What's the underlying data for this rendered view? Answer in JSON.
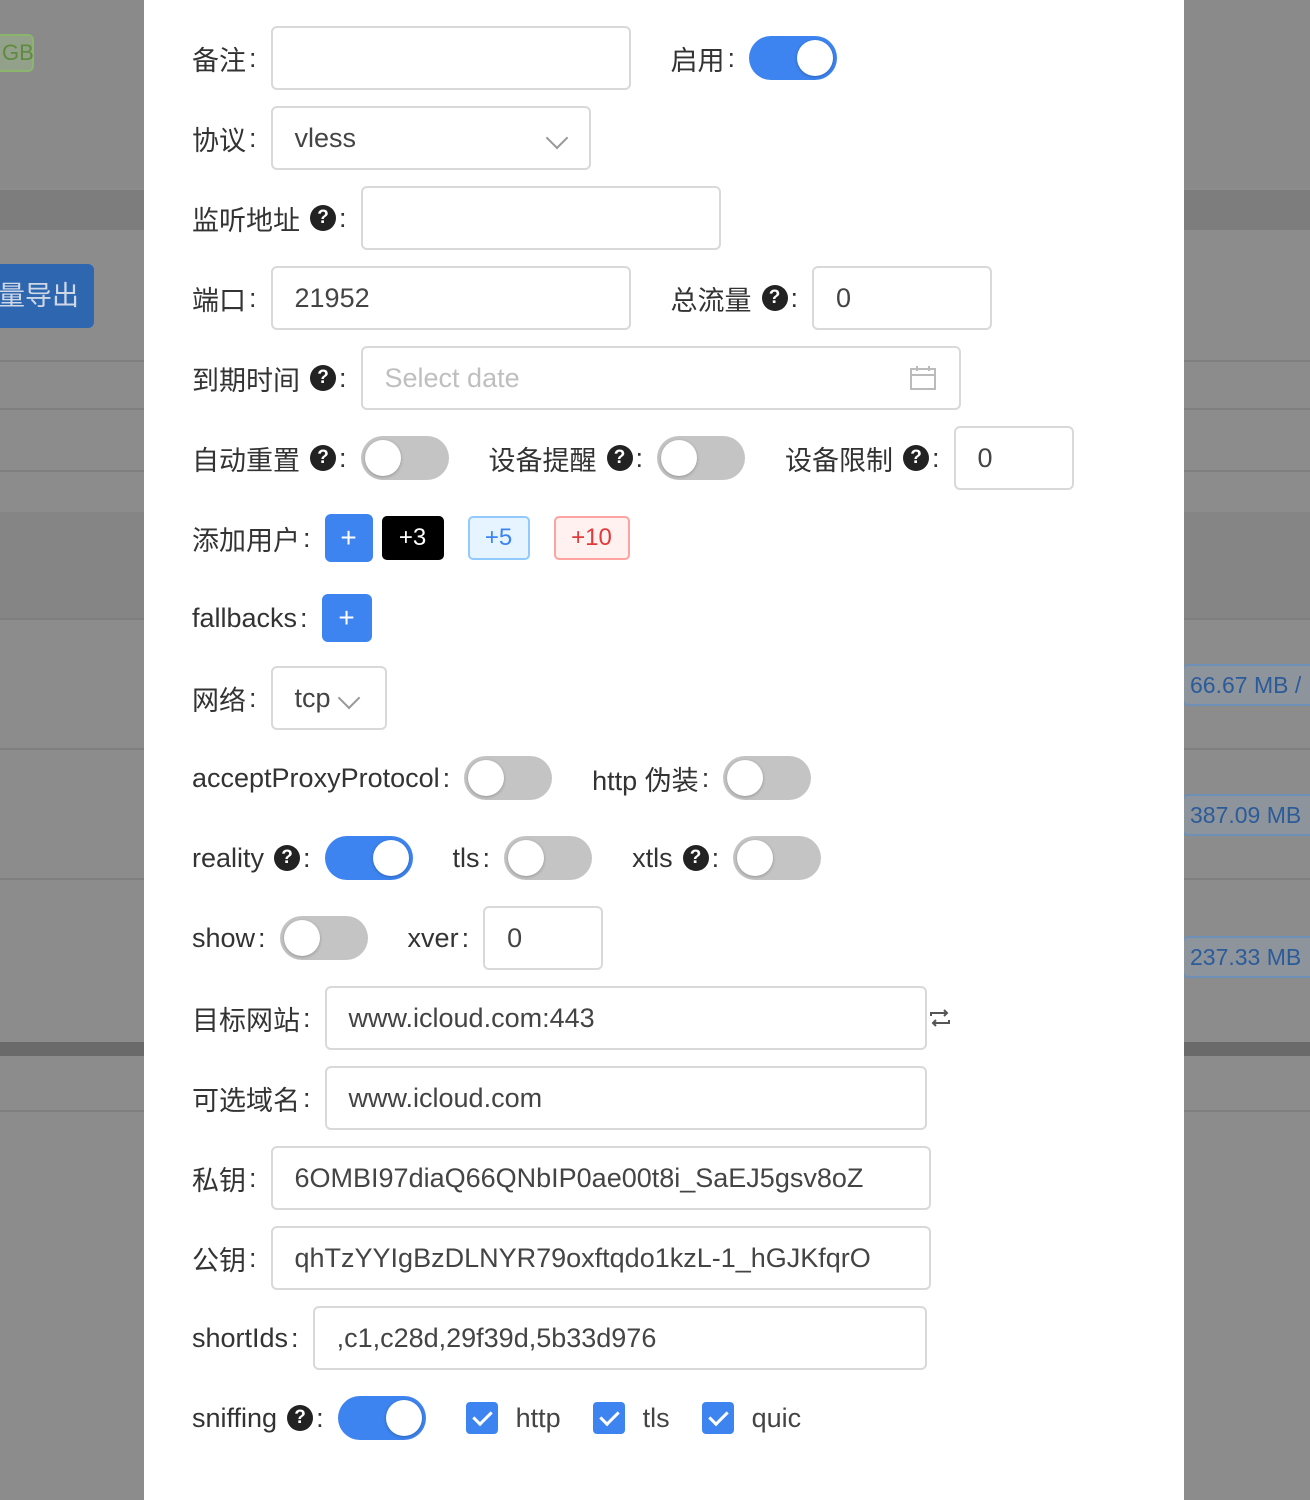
{
  "background": {
    "tag_text": "GB",
    "export_label": "量导出",
    "traffic_values": [
      "66.67 MB /",
      "387.09 MB",
      "237.33 MB"
    ]
  },
  "form": {
    "remark": {
      "label": "备注",
      "value": ""
    },
    "enable": {
      "label": "启用",
      "on": true
    },
    "protocol": {
      "label": "协议",
      "value": "vless"
    },
    "listen": {
      "label": "监听地址",
      "value": ""
    },
    "port": {
      "label": "端口",
      "value": "21952"
    },
    "total_traffic": {
      "label": "总流量",
      "value": "0"
    },
    "expiry": {
      "label": "到期时间",
      "placeholder": "Select date"
    },
    "auto_reset": {
      "label": "自动重置",
      "on": false
    },
    "device_alert": {
      "label": "设备提醒",
      "on": false
    },
    "device_limit": {
      "label": "设备限制",
      "value": "0"
    },
    "add_user": {
      "label": "添加用户",
      "plus": "+",
      "b3": "+3",
      "b5": "+5",
      "b10": "+10"
    },
    "fallbacks": {
      "label": "fallbacks",
      "plus": "+"
    },
    "network": {
      "label": "网络",
      "value": "tcp"
    },
    "accept_proxy": {
      "label": "acceptProxyProtocol",
      "on": false
    },
    "http_camouflage": {
      "label": "http 伪装",
      "on": false
    },
    "reality": {
      "label": "reality",
      "on": true
    },
    "tls": {
      "label": "tls",
      "on": false
    },
    "xtls": {
      "label": "xtls",
      "on": false
    },
    "show": {
      "label": "show",
      "on": false
    },
    "xver": {
      "label": "xver",
      "value": "0"
    },
    "target_site": {
      "label": "目标网站",
      "value": "www.icloud.com:443"
    },
    "server_names": {
      "label": "可选域名",
      "value": "www.icloud.com"
    },
    "private_key": {
      "label": "私钥",
      "value": "6OMBI97diaQ66QNbIP0ae00t8i_SaEJ5gsv8oZ"
    },
    "public_key": {
      "label": "公钥",
      "value": "qhTzYYIgBzDLNYR79oxftqdo1kzL-1_hGJKfqrO"
    },
    "short_ids": {
      "label": "shortIds",
      "value": ",c1,c28d,29f39d,5b33d976"
    },
    "sniffing": {
      "label": "sniffing",
      "on": true,
      "options": [
        "http",
        "tls",
        "quic"
      ]
    }
  },
  "colors": {
    "accent": "#3d84f0",
    "switch_off": "#c4c4c4",
    "danger": "#e03a3a"
  }
}
